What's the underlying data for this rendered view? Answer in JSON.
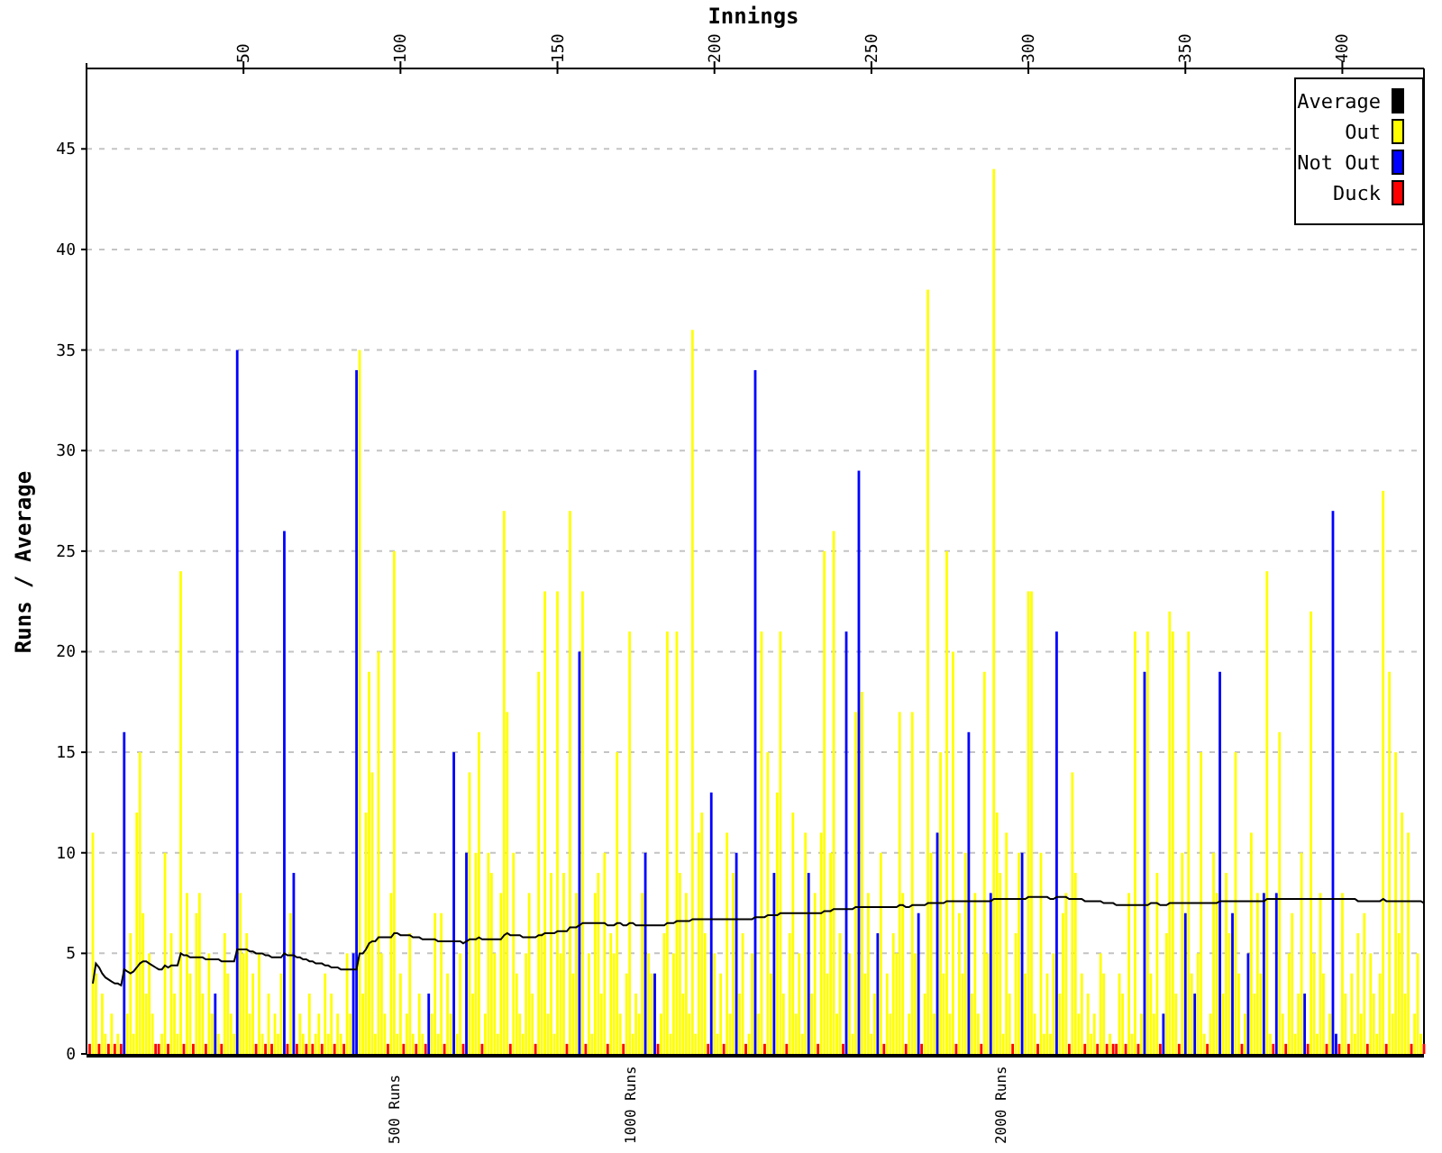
{
  "chart": {
    "chart_data": {
      "type": "bar",
      "xlabel": "Innings",
      "ylabel": "Runs / Average",
      "xlim": [
        0,
        426
      ],
      "ylim": [
        0,
        49
      ],
      "grid": true,
      "legend": "upper right",
      "xticks": [
        50,
        100,
        150,
        200,
        250,
        300,
        350,
        400
      ],
      "yticks": [
        0,
        5,
        10,
        15,
        20,
        25,
        30,
        35,
        40,
        45
      ],
      "x": [
        1,
        2,
        3,
        4,
        5,
        6,
        7,
        8,
        9,
        10,
        11,
        12,
        13,
        14,
        15,
        16,
        17,
        18,
        19,
        20,
        21,
        22,
        23,
        24,
        25,
        26,
        27,
        28,
        29,
        30,
        31,
        32,
        33,
        34,
        35,
        36,
        37,
        38,
        39,
        40,
        41,
        42,
        43,
        44,
        45,
        46,
        47,
        48,
        49,
        50,
        51,
        52,
        53,
        54,
        55,
        56,
        57,
        58,
        59,
        60,
        61,
        62,
        63,
        64,
        65,
        66,
        67,
        68,
        69,
        70,
        71,
        72,
        73,
        74,
        75,
        76,
        77,
        78,
        79,
        80,
        81,
        82,
        83,
        84,
        85,
        86,
        87,
        88,
        89,
        90,
        91,
        92,
        93,
        94,
        95,
        96,
        97,
        98,
        99,
        100,
        101,
        102,
        103,
        104,
        105,
        106,
        107,
        108,
        109,
        110,
        111,
        112,
        113,
        114,
        115,
        116,
        117,
        118,
        119,
        120,
        121,
        122,
        123,
        124,
        125,
        126,
        127,
        128,
        129,
        130,
        131,
        132,
        133,
        134,
        135,
        136,
        137,
        138,
        139,
        140,
        141,
        142,
        143,
        144,
        145,
        146,
        147,
        148,
        149,
        150,
        151,
        152,
        153,
        154,
        155,
        156,
        157,
        158,
        159,
        160,
        161,
        162,
        163,
        164,
        165,
        166,
        167,
        168,
        169,
        170,
        171,
        172,
        173,
        174,
        175,
        176,
        177,
        178,
        179,
        180,
        181,
        182,
        183,
        184,
        185,
        186,
        187,
        188,
        189,
        190,
        191,
        192,
        193,
        194,
        195,
        196,
        197,
        198,
        199,
        200,
        201,
        202,
        203,
        204,
        205,
        206,
        207,
        208,
        209,
        210,
        211,
        212,
        213,
        214,
        215,
        216,
        217,
        218,
        219,
        220,
        221,
        222,
        223,
        224,
        225,
        226,
        227,
        228,
        229,
        230,
        231,
        232,
        233,
        234,
        235,
        236,
        237,
        238,
        239,
        240,
        241,
        242,
        243,
        244,
        245,
        246,
        247,
        248,
        249,
        250,
        251,
        252,
        253,
        254,
        255,
        256,
        257,
        258,
        259,
        260,
        261,
        262,
        263,
        264,
        265,
        266,
        267,
        268,
        269,
        270,
        271,
        272,
        273,
        274,
        275,
        276,
        277,
        278,
        279,
        280,
        281,
        282,
        283,
        284,
        285,
        286,
        287,
        288,
        289,
        290,
        291,
        292,
        293,
        294,
        295,
        296,
        297,
        298,
        299,
        300,
        301,
        302,
        303,
        304,
        305,
        306,
        307,
        308,
        309,
        310,
        311,
        312,
        313,
        314,
        315,
        316,
        317,
        318,
        319,
        320,
        321,
        322,
        323,
        324,
        325,
        326,
        327,
        328,
        329,
        330,
        331,
        332,
        333,
        334,
        335,
        336,
        337,
        338,
        339,
        340,
        341,
        342,
        343,
        344,
        345,
        346,
        347,
        348,
        349,
        350,
        351,
        352,
        353,
        354,
        355,
        356,
        357,
        358,
        359,
        360,
        361,
        362,
        363,
        364,
        365,
        366,
        367,
        368,
        369,
        370,
        371,
        372,
        373,
        374,
        375,
        376,
        377,
        378,
        379,
        380,
        381,
        382,
        383,
        384,
        385,
        386,
        387,
        388,
        389,
        390,
        391,
        392,
        393,
        394,
        395,
        396,
        397,
        398,
        399,
        400,
        401,
        402,
        403,
        404,
        405,
        406,
        407,
        408,
        409,
        410,
        411,
        412,
        413,
        414,
        415,
        416,
        417,
        418,
        419,
        420,
        421,
        422,
        423,
        424,
        425,
        426
      ],
      "series": [
        {
          "name": "Average",
          "type": "line",
          "color": "#000000",
          "values": [
            null,
            3.5,
            4.5,
            4.3,
            4,
            3.8,
            3.7,
            3.6,
            3.5,
            3.5,
            3.4,
            4.2,
            4.1,
            4,
            4.1,
            4.3,
            4.5,
            4.6,
            4.6,
            4.5,
            4.4,
            4.3,
            4.2,
            4.2,
            4.4,
            4.3,
            4.4,
            4.4,
            4.4,
            5,
            4.9,
            4.9,
            4.8,
            4.8,
            4.8,
            4.8,
            4.8,
            4.7,
            4.7,
            4.7,
            4.7,
            4.7,
            4.6,
            4.6,
            4.6,
            4.6,
            4.6,
            5.2,
            5.2,
            5.2,
            5.2,
            5.1,
            5.1,
            5,
            5,
            5,
            4.9,
            4.9,
            4.8,
            4.8,
            4.8,
            4.8,
            5,
            4.9,
            4.9,
            4.9,
            4.8,
            4.8,
            4.7,
            4.7,
            4.6,
            4.6,
            4.5,
            4.5,
            4.5,
            4.4,
            4.4,
            4.3,
            4.3,
            4.3,
            4.2,
            4.2,
            4.2,
            4.2,
            4.2,
            4.2,
            5,
            5,
            5.2,
            5.5,
            5.6,
            5.6,
            5.8,
            5.8,
            5.8,
            5.8,
            5.8,
            6,
            6,
            5.9,
            5.9,
            5.9,
            5.9,
            5.8,
            5.8,
            5.8,
            5.7,
            5.7,
            5.7,
            5.7,
            5.7,
            5.6,
            5.6,
            5.6,
            5.6,
            5.6,
            5.6,
            5.6,
            5.6,
            5.5,
            5.6,
            5.7,
            5.7,
            5.7,
            5.8,
            5.7,
            5.7,
            5.7,
            5.7,
            5.7,
            5.7,
            5.7,
            5.9,
            6,
            5.9,
            5.9,
            5.9,
            5.9,
            5.8,
            5.8,
            5.8,
            5.8,
            5.8,
            5.9,
            5.9,
            6,
            6,
            6,
            6,
            6.1,
            6.1,
            6.1,
            6.1,
            6.3,
            6.3,
            6.3,
            6.4,
            6.5,
            6.5,
            6.5,
            6.5,
            6.5,
            6.5,
            6.5,
            6.5,
            6.4,
            6.4,
            6.4,
            6.5,
            6.5,
            6.4,
            6.4,
            6.5,
            6.5,
            6.4,
            6.4,
            6.4,
            6.4,
            6.4,
            6.4,
            6.4,
            6.4,
            6.4,
            6.4,
            6.5,
            6.5,
            6.5,
            6.6,
            6.6,
            6.6,
            6.6,
            6.6,
            6.7,
            6.7,
            6.7,
            6.7,
            6.7,
            6.7,
            6.7,
            6.7,
            6.7,
            6.7,
            6.7,
            6.7,
            6.7,
            6.7,
            6.7,
            6.7,
            6.7,
            6.7,
            6.7,
            6.7,
            6.8,
            6.8,
            6.8,
            6.8,
            6.9,
            6.9,
            6.9,
            6.9,
            7,
            7,
            7,
            7,
            7,
            7,
            7,
            7,
            7,
            7,
            7,
            7,
            7,
            7,
            7.1,
            7.1,
            7.1,
            7.2,
            7.2,
            7.2,
            7.2,
            7.2,
            7.2,
            7.2,
            7.3,
            7.3,
            7.3,
            7.3,
            7.3,
            7.3,
            7.3,
            7.3,
            7.3,
            7.3,
            7.3,
            7.3,
            7.3,
            7.3,
            7.4,
            7.4,
            7.3,
            7.3,
            7.4,
            7.4,
            7.4,
            7.4,
            7.4,
            7.5,
            7.5,
            7.5,
            7.5,
            7.5,
            7.5,
            7.6,
            7.6,
            7.6,
            7.6,
            7.6,
            7.6,
            7.6,
            7.6,
            7.6,
            7.6,
            7.6,
            7.6,
            7.6,
            7.6,
            7.6,
            7.7,
            7.7,
            7.7,
            7.7,
            7.7,
            7.7,
            7.7,
            7.7,
            7.7,
            7.7,
            7.7,
            7.8,
            7.8,
            7.8,
            7.8,
            7.8,
            7.8,
            7.8,
            7.7,
            7.7,
            7.8,
            7.8,
            7.8,
            7.8,
            7.7,
            7.7,
            7.7,
            7.7,
            7.7,
            7.6,
            7.6,
            7.6,
            7.6,
            7.6,
            7.6,
            7.5,
            7.5,
            7.5,
            7.5,
            7.4,
            7.4,
            7.4,
            7.4,
            7.4,
            7.4,
            7.4,
            7.4,
            7.4,
            7.4,
            7.4,
            7.5,
            7.5,
            7.5,
            7.4,
            7.4,
            7.4,
            7.5,
            7.5,
            7.5,
            7.5,
            7.5,
            7.5,
            7.5,
            7.5,
            7.5,
            7.5,
            7.5,
            7.5,
            7.5,
            7.5,
            7.5,
            7.5,
            7.6,
            7.6,
            7.6,
            7.6,
            7.6,
            7.6,
            7.6,
            7.6,
            7.6,
            7.6,
            7.6,
            7.6,
            7.6,
            7.6,
            7.6,
            7.7,
            7.7,
            7.7,
            7.7,
            7.7,
            7.7,
            7.7,
            7.7,
            7.7,
            7.7,
            7.7,
            7.7,
            7.7,
            7.7,
            7.7,
            7.7,
            7.7,
            7.7,
            7.7,
            7.7,
            7.7,
            7.7,
            7.7,
            7.7,
            7.7,
            7.7,
            7.7,
            7.7,
            7.7,
            7.6,
            7.6,
            7.6,
            7.6,
            7.6,
            7.6,
            7.6,
            7.6,
            7.7,
            7.6,
            7.6,
            7.6,
            7.6,
            7.6,
            7.6,
            7.6,
            7.6,
            7.6,
            7.6,
            7.6,
            7.6,
            7.5
          ]
        },
        {
          "name": "Out",
          "color": "#ffff00",
          "values": [
            null,
            11,
            4,
            null,
            3,
            1,
            null,
            2,
            null,
            1,
            null,
            null,
            2,
            6,
            1,
            12,
            15,
            7,
            3,
            5,
            2,
            null,
            null,
            1,
            10,
            null,
            6,
            3,
            1,
            24,
            null,
            8,
            4,
            null,
            7,
            8,
            3,
            null,
            5,
            2,
            null,
            1,
            null,
            6,
            4,
            2,
            1,
            null,
            8,
            5,
            6,
            2,
            4,
            null,
            5,
            1,
            null,
            3,
            null,
            2,
            1,
            4,
            null,
            null,
            7,
            null,
            null,
            2,
            1,
            null,
            3,
            null,
            1,
            2,
            null,
            4,
            1,
            3,
            null,
            2,
            1,
            null,
            5,
            2,
            null,
            null,
            35,
            3,
            12,
            19,
            14,
            1,
            20,
            5,
            2,
            null,
            8,
            25,
            1,
            4,
            null,
            2,
            6,
            1,
            null,
            3,
            1,
            null,
            null,
            2,
            7,
            1,
            7,
            null,
            4,
            2,
            null,
            1,
            5,
            null,
            null,
            14,
            3,
            10,
            16,
            null,
            2,
            10,
            9,
            5,
            1,
            8,
            27,
            17,
            null,
            10,
            4,
            2,
            1,
            5,
            8,
            3,
            null,
            19,
            6,
            23,
            2,
            9,
            1,
            23,
            5,
            9,
            null,
            27,
            4,
            8,
            null,
            23,
            null,
            5,
            1,
            8,
            9,
            3,
            10,
            null,
            6,
            5,
            15,
            2,
            null,
            4,
            21,
            1,
            3,
            2,
            8,
            null,
            5,
            4,
            null,
            null,
            2,
            6,
            21,
            1,
            5,
            21,
            9,
            3,
            8,
            2,
            36,
            1,
            11,
            12,
            6,
            null,
            null,
            5,
            1,
            4,
            null,
            11,
            2,
            9,
            null,
            3,
            6,
            null,
            1,
            5,
            null,
            2,
            21,
            null,
            15,
            4,
            null,
            13,
            21,
            3,
            null,
            6,
            12,
            2,
            5,
            1,
            11,
            null,
            3,
            8,
            null,
            11,
            25,
            4,
            10,
            26,
            2,
            6,
            null,
            null,
            5,
            1,
            17,
            null,
            18,
            4,
            8,
            1,
            3,
            null,
            10,
            null,
            4,
            2,
            6,
            5,
            17,
            8,
            null,
            2,
            17,
            5,
            null,
            null,
            3,
            38,
            10,
            2,
            null,
            15,
            4,
            25,
            2,
            20,
            null,
            7,
            4,
            10,
            null,
            3,
            8,
            2,
            null,
            19,
            5,
            null,
            44,
            12,
            9,
            1,
            11,
            3,
            null,
            6,
            10,
            null,
            4,
            23,
            23,
            2,
            null,
            10,
            1,
            4,
            1,
            5,
            null,
            3,
            7,
            8,
            null,
            14,
            9,
            2,
            4,
            null,
            3,
            1,
            2,
            null,
            5,
            4,
            null,
            1,
            null,
            null,
            4,
            3,
            null,
            8,
            1,
            21,
            null,
            2,
            null,
            21,
            4,
            2,
            9,
            null,
            null,
            6,
            22,
            21,
            3,
            null,
            10,
            null,
            21,
            4,
            null,
            5,
            15,
            1,
            null,
            2,
            10,
            8,
            null,
            3,
            9,
            6,
            null,
            15,
            4,
            null,
            2,
            null,
            11,
            3,
            8,
            4,
            null,
            24,
            1,
            null,
            null,
            16,
            2,
            null,
            5,
            7,
            1,
            3,
            10,
            null,
            null,
            22,
            5,
            1,
            8,
            4,
            null,
            2,
            null,
            null,
            null,
            8,
            3,
            null,
            4,
            1,
            6,
            2,
            7,
            null,
            5,
            3,
            1,
            4,
            28,
            null,
            19,
            2,
            15,
            6,
            12,
            3,
            11,
            null,
            2,
            5,
            1,
            null
          ]
        },
        {
          "name": "Not Out",
          "color": "#0000ff",
          "values": [
            null,
            null,
            null,
            null,
            null,
            null,
            null,
            null,
            null,
            null,
            null,
            16,
            null,
            null,
            null,
            null,
            null,
            null,
            null,
            null,
            null,
            null,
            null,
            null,
            null,
            null,
            null,
            null,
            null,
            null,
            null,
            null,
            null,
            null,
            null,
            null,
            null,
            null,
            null,
            null,
            3,
            null,
            null,
            null,
            null,
            null,
            null,
            35,
            null,
            null,
            null,
            null,
            null,
            null,
            null,
            null,
            null,
            null,
            null,
            null,
            null,
            null,
            26,
            null,
            null,
            9,
            null,
            null,
            null,
            null,
            null,
            null,
            null,
            null,
            null,
            null,
            null,
            null,
            null,
            null,
            null,
            null,
            null,
            null,
            5,
            34,
            null,
            null,
            null,
            null,
            null,
            null,
            null,
            null,
            null,
            null,
            null,
            null,
            null,
            null,
            null,
            null,
            null,
            null,
            null,
            null,
            null,
            null,
            3,
            null,
            null,
            null,
            null,
            null,
            null,
            null,
            15,
            null,
            null,
            null,
            10,
            null,
            null,
            null,
            null,
            null,
            null,
            null,
            null,
            null,
            null,
            null,
            null,
            null,
            null,
            null,
            null,
            null,
            null,
            null,
            null,
            null,
            null,
            null,
            null,
            null,
            null,
            null,
            null,
            null,
            null,
            null,
            null,
            null,
            null,
            null,
            20,
            null,
            null,
            null,
            null,
            null,
            null,
            null,
            null,
            null,
            null,
            null,
            null,
            null,
            null,
            null,
            null,
            null,
            null,
            null,
            null,
            10,
            null,
            null,
            4,
            null,
            null,
            null,
            null,
            null,
            null,
            null,
            null,
            null,
            null,
            null,
            null,
            null,
            null,
            null,
            null,
            null,
            13,
            null,
            null,
            null,
            null,
            null,
            null,
            null,
            10,
            null,
            null,
            null,
            null,
            null,
            34,
            null,
            null,
            null,
            null,
            null,
            9,
            null,
            null,
            null,
            null,
            null,
            null,
            null,
            null,
            null,
            null,
            9,
            null,
            null,
            null,
            null,
            null,
            null,
            null,
            null,
            null,
            null,
            null,
            21,
            null,
            null,
            null,
            29,
            null,
            null,
            null,
            null,
            null,
            6,
            null,
            null,
            null,
            null,
            null,
            null,
            null,
            null,
            null,
            null,
            null,
            null,
            7,
            null,
            null,
            null,
            null,
            null,
            11,
            null,
            null,
            null,
            null,
            null,
            null,
            null,
            null,
            null,
            16,
            null,
            null,
            null,
            null,
            null,
            null,
            8,
            null,
            null,
            null,
            null,
            null,
            null,
            null,
            null,
            null,
            10,
            null,
            null,
            null,
            null,
            null,
            null,
            null,
            null,
            null,
            null,
            21,
            null,
            null,
            null,
            null,
            null,
            null,
            null,
            null,
            null,
            null,
            null,
            null,
            null,
            null,
            null,
            null,
            null,
            null,
            null,
            null,
            null,
            null,
            null,
            null,
            null,
            null,
            null,
            19,
            null,
            null,
            null,
            null,
            null,
            2,
            null,
            null,
            null,
            null,
            null,
            null,
            7,
            null,
            null,
            3,
            null,
            null,
            null,
            null,
            null,
            null,
            null,
            19,
            null,
            null,
            null,
            7,
            null,
            null,
            null,
            null,
            5,
            null,
            null,
            null,
            null,
            8,
            null,
            null,
            null,
            8,
            null,
            null,
            null,
            null,
            null,
            null,
            null,
            null,
            3,
            null,
            null,
            null,
            null,
            null,
            null,
            null,
            null,
            27,
            1,
            null,
            null,
            null,
            null,
            null,
            null,
            null,
            null,
            null,
            null,
            null,
            null,
            null,
            null,
            null,
            null,
            null,
            null,
            null,
            null,
            null,
            null,
            null,
            null,
            null,
            null,
            null,
            null
          ]
        },
        {
          "name": "Duck",
          "color": "#ff0000",
          "values": [
            0.5,
            null,
            null,
            0.5,
            null,
            null,
            0.5,
            null,
            0.5,
            null,
            0.5,
            null,
            null,
            null,
            null,
            null,
            null,
            null,
            null,
            null,
            null,
            0.5,
            0.5,
            null,
            null,
            0.5,
            null,
            null,
            null,
            null,
            0.5,
            null,
            null,
            0.5,
            null,
            null,
            null,
            0.5,
            null,
            null,
            null,
            null,
            0.5,
            null,
            null,
            null,
            null,
            null,
            null,
            null,
            null,
            null,
            null,
            0.5,
            null,
            null,
            0.5,
            null,
            0.5,
            null,
            null,
            null,
            null,
            0.5,
            null,
            null,
            0.5,
            null,
            null,
            0.5,
            null,
            0.5,
            null,
            null,
            0.5,
            null,
            null,
            null,
            0.5,
            null,
            null,
            0.5,
            null,
            null,
            null,
            null,
            null,
            null,
            null,
            null,
            null,
            null,
            null,
            null,
            null,
            0.5,
            null,
            null,
            null,
            null,
            0.5,
            null,
            null,
            null,
            0.5,
            null,
            null,
            0.5,
            null,
            null,
            null,
            null,
            null,
            0.5,
            null,
            null,
            null,
            null,
            null,
            0.5,
            null,
            null,
            null,
            null,
            null,
            0.5,
            null,
            null,
            null,
            null,
            null,
            null,
            null,
            null,
            0.5,
            null,
            null,
            null,
            null,
            null,
            null,
            null,
            0.5,
            null,
            null,
            null,
            null,
            null,
            null,
            null,
            null,
            null,
            0.5,
            null,
            null,
            null,
            null,
            null,
            0.5,
            null,
            null,
            null,
            null,
            null,
            null,
            0.5,
            null,
            null,
            null,
            null,
            0.5,
            null,
            null,
            null,
            null,
            null,
            null,
            null,
            null,
            null,
            null,
            0.5,
            null,
            null,
            null,
            null,
            null,
            null,
            null,
            null,
            null,
            null,
            null,
            null,
            null,
            null,
            null,
            0.5,
            null,
            null,
            null,
            null,
            0.5,
            null,
            null,
            null,
            null,
            null,
            null,
            0.5,
            null,
            null,
            null,
            null,
            null,
            0.5,
            null,
            null,
            null,
            null,
            null,
            null,
            0.5,
            null,
            null,
            null,
            null,
            null,
            null,
            null,
            null,
            null,
            0.5,
            null,
            null,
            null,
            null,
            null,
            null,
            null,
            0.5,
            null,
            null,
            null,
            null,
            null,
            null,
            null,
            null,
            null,
            null,
            null,
            null,
            0.5,
            null,
            null,
            null,
            null,
            null,
            null,
            0.5,
            null,
            null,
            null,
            null,
            0.5,
            null,
            null,
            null,
            null,
            null,
            null,
            null,
            null,
            null,
            null,
            0.5,
            null,
            null,
            null,
            null,
            null,
            null,
            null,
            0.5,
            null,
            null,
            null,
            null,
            null,
            null,
            null,
            null,
            null,
            0.5,
            null,
            null,
            null,
            null,
            null,
            null,
            null,
            0.5,
            null,
            null,
            null,
            null,
            null,
            null,
            null,
            null,
            null,
            0.5,
            null,
            null,
            null,
            null,
            0.5,
            null,
            null,
            null,
            0.5,
            null,
            null,
            0.5,
            null,
            0.5,
            0.5,
            null,
            null,
            0.5,
            null,
            null,
            null,
            0.5,
            null,
            null,
            null,
            null,
            null,
            null,
            0.5,
            null,
            null,
            null,
            null,
            null,
            0.5,
            null,
            null,
            null,
            null,
            null,
            null,
            null,
            null,
            0.5,
            null,
            null,
            null,
            null,
            null,
            null,
            null,
            null,
            null,
            null,
            0.5,
            null,
            null,
            null,
            null,
            null,
            null,
            null,
            null,
            null,
            0.5,
            null,
            null,
            null,
            0.5,
            null,
            null,
            null,
            null,
            null,
            null,
            0.5,
            null,
            null,
            null,
            null,
            null,
            0.5,
            null,
            null,
            null,
            0.5,
            null,
            null,
            0.5,
            null,
            null,
            null,
            null,
            null,
            0.5,
            null,
            null,
            null,
            null,
            null,
            0.5,
            null,
            null,
            null,
            null,
            null,
            null,
            null,
            0.5,
            null,
            null,
            null,
            0.5
          ]
        }
      ],
      "annotations": [
        "500 Runs",
        "1000 Runs",
        "2000 Runs"
      ]
    }
  }
}
